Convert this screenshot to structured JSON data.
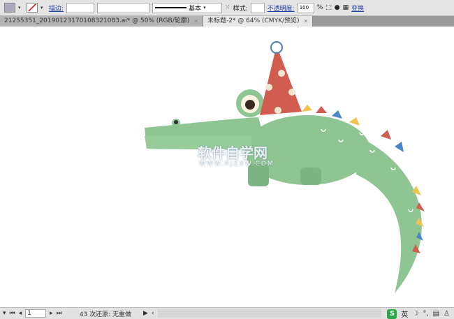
{
  "toolbar": {
    "stroke_label": "描边:",
    "stroke_style": "基本",
    "style_label": "样式:",
    "opacity_label": "不透明度:",
    "opacity_value": "100",
    "percent": "%",
    "transform_label": "变换"
  },
  "tabs": [
    {
      "label": "21255351_20190123170108321083.ai* @ 50% (RGB/轮廓)"
    },
    {
      "label": "未标题-2* @ 64% (CMYK/预览)"
    }
  ],
  "canvas": {
    "watermark_cn": "软件自学网",
    "watermark_url": "WWW.RJZXW.COM",
    "colors": {
      "body": "#8ec592",
      "hat": "#d15c50",
      "accent": "#f0c24e"
    }
  },
  "status": {
    "page": "1",
    "undo_text": "43 次还原: 无重做"
  },
  "ime": {
    "lang": "英"
  }
}
